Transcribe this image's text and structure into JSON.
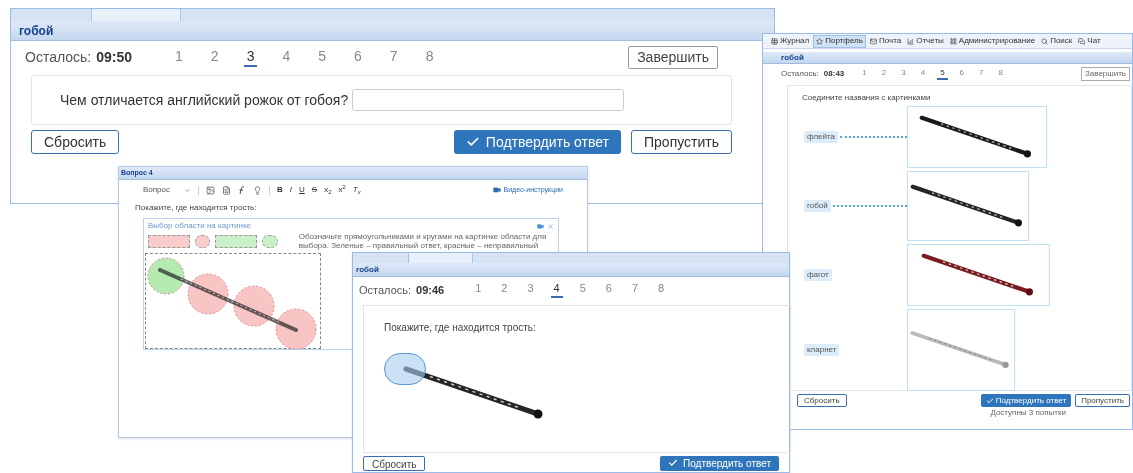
{
  "text_question_window": {
    "title": "гобой",
    "timer_label": "Осталось:",
    "timer": "09:50",
    "pages": [
      {
        "label": "1",
        "selected": false
      },
      {
        "label": "2",
        "selected": false
      },
      {
        "label": "3",
        "selected": true
      },
      {
        "label": "4",
        "selected": false
      },
      {
        "label": "5",
        "selected": false
      },
      {
        "label": "6",
        "selected": false
      },
      {
        "label": "7",
        "selected": false
      },
      {
        "label": "8",
        "selected": false
      }
    ],
    "finish": "Завершить",
    "question": "Чем отличается английский рожок от гобоя?",
    "reset": "Сбросить",
    "confirm": "Подтвердить ответ",
    "skip": "Пропустить"
  },
  "editor_window": {
    "title": "Вопрос 4",
    "block_format": "Вопрос",
    "format_tools": [
      "B",
      "I",
      "U",
      "S",
      "x$_{2}$",
      "x$^{2}$",
      "T$_{x}$"
    ],
    "video_link": "Видео-инструкции",
    "prompt": "Покажите, где находится трость:",
    "area_panel": {
      "title": "Выбор области на картинке",
      "shape_tools": [
        {
          "kind": "rect",
          "color": "#f9cccc"
        },
        {
          "kind": "circle",
          "color": "#f9cccc"
        },
        {
          "kind": "rect",
          "color": "#c9f0c9"
        },
        {
          "kind": "circle",
          "color": "#c9f0c9"
        }
      ],
      "hint": "Обозначьте прямоугольниками и кругами на картинке области для выбора. Зеленые – правильный ответ, красные – неправильный",
      "regions": [
        {
          "color": "#b5eab0"
        },
        {
          "color": "#f9c4c4"
        },
        {
          "color": "#f9c4c4"
        },
        {
          "color": "#f9c4c4"
        }
      ]
    }
  },
  "matching_window": {
    "menu": [
      {
        "label": "Журнал",
        "selected": false
      },
      {
        "label": "Портфель",
        "selected": true
      },
      {
        "label": "Почта",
        "selected": false
      },
      {
        "label": "Отчеты",
        "selected": false
      },
      {
        "label": "Администрирование",
        "selected": false
      },
      {
        "label": "Поиск",
        "selected": false
      },
      {
        "label": "Чат",
        "selected": false
      }
    ],
    "title": "гобой",
    "timer_label": "Осталось:",
    "timer": "08:43",
    "pages": [
      {
        "label": "1",
        "selected": false
      },
      {
        "label": "2",
        "selected": false
      },
      {
        "label": "3",
        "selected": false
      },
      {
        "label": "4",
        "selected": false
      },
      {
        "label": "5",
        "selected": true
      },
      {
        "label": "6",
        "selected": false
      },
      {
        "label": "7",
        "selected": false
      },
      {
        "label": "8",
        "selected": false
      }
    ],
    "finish": "Завершить",
    "prompt": "Соедините названия с картинками",
    "pairs": [
      {
        "label": "флейта",
        "linked": true
      },
      {
        "label": "гобой",
        "linked": true
      },
      {
        "label": "фагот",
        "linked": false
      },
      {
        "label": "кларнет",
        "linked": false
      }
    ],
    "reset": "Сбросить",
    "confirm": "Подтвердить ответ",
    "skip": "Пропустить",
    "attempts": "Доступны 3 попытки"
  },
  "image_question_window": {
    "title": "гобой",
    "timer_label": "Осталось:",
    "timer": "09:46",
    "pages": [
      {
        "label": "1",
        "selected": false
      },
      {
        "label": "2",
        "selected": false
      },
      {
        "label": "3",
        "selected": false
      },
      {
        "label": "4",
        "selected": true
      },
      {
        "label": "5",
        "selected": false
      },
      {
        "label": "6",
        "selected": false
      },
      {
        "label": "7",
        "selected": false
      },
      {
        "label": "8",
        "selected": false
      }
    ],
    "prompt": "Покажите, где находится трость:",
    "reset": "Сбросить",
    "confirm": "Подтвердить ответ"
  }
}
